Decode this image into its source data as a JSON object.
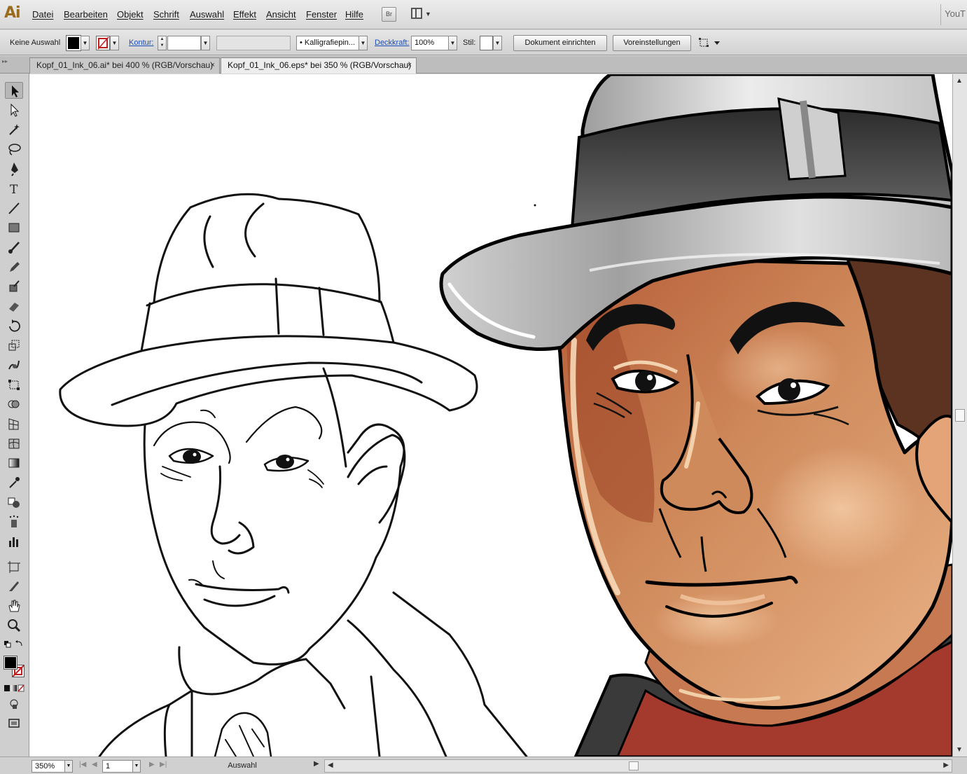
{
  "app": {
    "logo": "Ai",
    "corner_text": "YouT"
  },
  "menu": [
    "Datei",
    "Bearbeiten",
    "Objekt",
    "Schrift",
    "Auswahl",
    "Effekt",
    "Ansicht",
    "Fenster",
    "Hilfe"
  ],
  "bridge_button": "Br",
  "control_bar": {
    "selection_label": "Keine Auswahl",
    "stroke_label": "Kontur:",
    "brush_value": "Kalligrafiepin...",
    "brush_bullet": "•",
    "opacity_label": "Deckkraft:",
    "opacity_value": "100%",
    "style_label": "Stil:",
    "document_setup_button": "Dokument einrichten",
    "preferences_button": "Voreinstellungen"
  },
  "tabs": [
    {
      "label": "Kopf_01_Ink_06.ai* bei 400 % (RGB/Vorschau)",
      "active": false
    },
    {
      "label": "Kopf_01_Ink_06.eps* bei 350 % (RGB/Vorschau)",
      "active": true
    }
  ],
  "tab_close_glyph": "×",
  "tools": [
    "selection-tool",
    "direct-selection-tool",
    "magic-wand-tool",
    "lasso-tool",
    "pen-tool",
    "type-tool",
    "line-tool",
    "rectangle-tool",
    "paintbrush-tool",
    "pencil-tool",
    "blob-brush-tool",
    "eraser-tool",
    "rotate-tool",
    "scale-tool",
    "warp-tool",
    "free-transform-tool",
    "shape-builder-tool",
    "perspective-grid-tool",
    "mesh-tool",
    "gradient-tool",
    "eyedropper-tool",
    "blend-tool",
    "symbol-sprayer-tool",
    "column-graph-tool",
    "artboard-tool",
    "slice-tool",
    "hand-tool",
    "zoom-tool"
  ],
  "colors": {
    "fill": "#000000",
    "stroke": "none",
    "skin_light": "#e8ae82",
    "skin_mid": "#c77a51",
    "skin_dark": "#8e4a2c",
    "hat_light": "#e4e4e4",
    "hat_dark": "#3a3a3a",
    "hair": "#5b3320",
    "collar": "#a23a2e"
  },
  "status_bar": {
    "zoom": "350%",
    "page": "1",
    "status_text": "Auswahl"
  }
}
